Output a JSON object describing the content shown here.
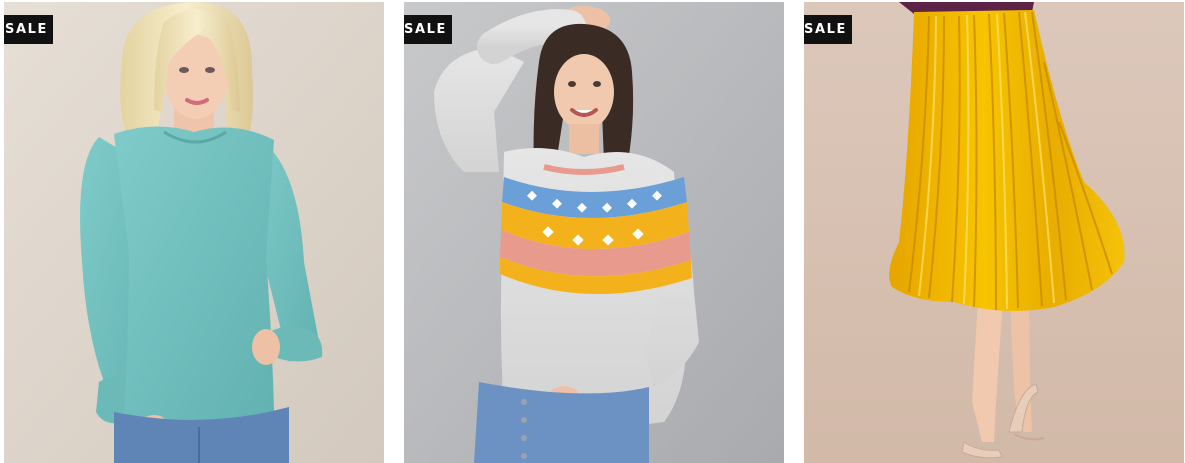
{
  "product_grid": {
    "products": [
      {
        "badge": "SALE",
        "image": "teal-long-sleeve-ruffle-top-photo",
        "colors": {
          "background": "#ded6cc",
          "garment": "#77c3c2",
          "denim": "#5f84b6",
          "hair": "#efe3b8"
        }
      },
      {
        "badge": "SALE",
        "image": "fair-isle-yoke-sweater-photo",
        "colors": {
          "background": "#b9babd",
          "garment": "#dedede",
          "accent_yellow": "#f3b21c",
          "accent_pink": "#e89a8c",
          "accent_blue": "#6a9fd8"
        }
      },
      {
        "badge": "SALE",
        "image": "mustard-pleated-satin-skirt-photo",
        "colors": {
          "background": "#d8c3b5",
          "garment": "#f0b800",
          "top": "#5d2346"
        }
      }
    ]
  }
}
